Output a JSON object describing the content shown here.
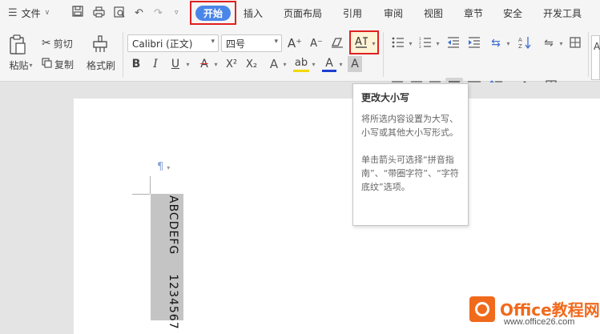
{
  "menubar": {
    "file_label": "文件",
    "tabs": [
      "开始",
      "插入",
      "页面布局",
      "引用",
      "审阅",
      "视图",
      "章节",
      "安全",
      "开发工具"
    ]
  },
  "ribbon": {
    "paste_label": "粘贴",
    "cut_label": "剪切",
    "copy_label": "复制",
    "format_painter_label": "格式刷",
    "font_name": "Calibri (正文)",
    "font_size": "四号",
    "bold": "B",
    "italic": "I",
    "underline": "U",
    "strike": "A",
    "superscript": "X²",
    "subscript": "X₂",
    "grow": "A⁺",
    "shrink": "A⁻",
    "font_color": "A",
    "char_shade": "A",
    "highlight": "ab",
    "effects": "A",
    "change_case": "Ꭺa",
    "right_partial": "A"
  },
  "tooltip": {
    "title": "更改大小写",
    "body": "将所选内容设置为大写、小写或其他大小写形式。\n\n单击箭头可选择“拼音指南”、“带圈字符”、“字符底纹”选项。"
  },
  "document": {
    "text_letters": "ABCDEFG",
    "text_digits": "1234567"
  },
  "watermark": {
    "title": "Office教程网",
    "url": "www.office26.com"
  },
  "colors": {
    "accent": "#4a86e8",
    "highlight_border": "#e02020",
    "watermark": "#f06a1c"
  }
}
